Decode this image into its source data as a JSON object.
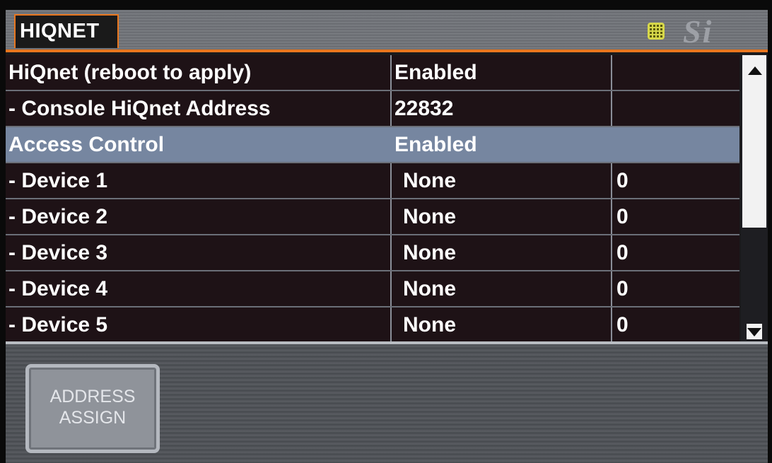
{
  "header": {
    "title": "HIQNET",
    "status_icon": "grid-icon",
    "logo_text": "Si",
    "accent_color": "#e8761e"
  },
  "table": {
    "rows": [
      {
        "label": "HiQnet (reboot to apply)",
        "value": "Enabled",
        "extra": ""
      },
      {
        "label": "- Console HiQnet Address",
        "value": "22832",
        "extra": ""
      },
      {
        "label": "Access Control",
        "value": "Enabled",
        "extra": "",
        "selected": true
      },
      {
        "label": "- Device 1",
        "value": "None",
        "extra": "0"
      },
      {
        "label": "- Device 2",
        "value": "None",
        "extra": "0"
      },
      {
        "label": "- Device 3",
        "value": "None",
        "extra": "0"
      },
      {
        "label": "- Device 4",
        "value": "None",
        "extra": "0"
      },
      {
        "label": "- Device 5",
        "value": "None",
        "extra": "0"
      }
    ]
  },
  "scrollbar": {
    "up_icon": "arrow-up-icon",
    "down_icon": "arrow-down-icon"
  },
  "footer": {
    "address_assign_label": "ADDRESS\nASSIGN"
  }
}
